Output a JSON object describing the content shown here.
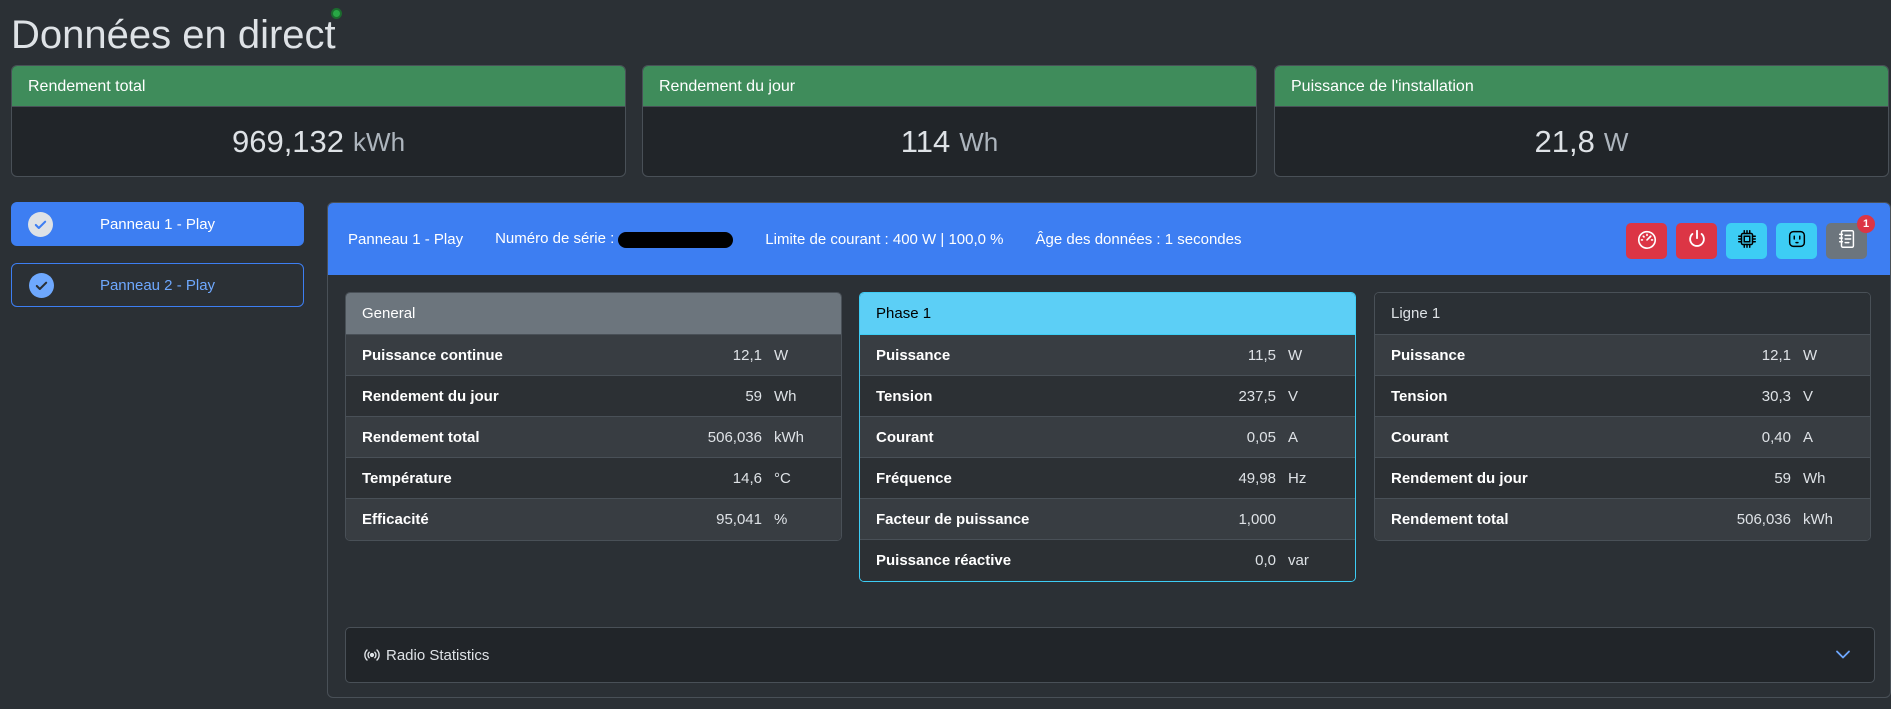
{
  "page": {
    "title": "Données en direct"
  },
  "summary": [
    {
      "label": "Rendement total",
      "value": "969,132",
      "unit": "kWh"
    },
    {
      "label": "Rendement du jour",
      "value": "114",
      "unit": "Wh"
    },
    {
      "label": "Puissance de l'installation",
      "value": "21,8",
      "unit": "W"
    }
  ],
  "inverters": [
    {
      "label": "Panneau 1 - Play",
      "active": true
    },
    {
      "label": "Panneau 2 - Play",
      "active": false
    }
  ],
  "inverter_header": {
    "name": "Panneau 1 - Play",
    "serial_label": "Numéro de série :",
    "limit": "Limite de courant : 400 W | 100,0 %",
    "age": "Âge des données : 1 secondes",
    "badge_count": "1"
  },
  "general": {
    "title": "General",
    "rows": [
      {
        "name": "Puissance continue",
        "value": "12,1",
        "unit": "W"
      },
      {
        "name": "Rendement du jour",
        "value": "59",
        "unit": "Wh"
      },
      {
        "name": "Rendement total",
        "value": "506,036",
        "unit": "kWh"
      },
      {
        "name": "Température",
        "value": "14,6",
        "unit": "°C"
      },
      {
        "name": "Efficacité",
        "value": "95,041",
        "unit": "%"
      }
    ]
  },
  "phase": {
    "title": "Phase 1",
    "rows": [
      {
        "name": "Puissance",
        "value": "11,5",
        "unit": "W"
      },
      {
        "name": "Tension",
        "value": "237,5",
        "unit": "V"
      },
      {
        "name": "Courant",
        "value": "0,05",
        "unit": "A"
      },
      {
        "name": "Fréquence",
        "value": "49,98",
        "unit": "Hz"
      },
      {
        "name": "Facteur de puissance",
        "value": "1,000",
        "unit": ""
      },
      {
        "name": "Puissance réactive",
        "value": "0,0",
        "unit": "var"
      }
    ]
  },
  "ligne": {
    "title": "Ligne 1",
    "rows": [
      {
        "name": "Puissance",
        "value": "12,1",
        "unit": "W"
      },
      {
        "name": "Tension",
        "value": "30,3",
        "unit": "V"
      },
      {
        "name": "Courant",
        "value": "0,40",
        "unit": "A"
      },
      {
        "name": "Rendement du jour",
        "value": "59",
        "unit": "Wh"
      },
      {
        "name": "Rendement total",
        "value": "506,036",
        "unit": "kWh"
      }
    ]
  },
  "radio": {
    "label": "Radio Statistics"
  },
  "colors": {
    "background": "#2b3035",
    "summary_header": "#3f8c5b",
    "primary": "#3d7ef2",
    "danger": "#dc3545",
    "info": "#3dcdf5",
    "secondary": "#6c757d"
  },
  "icons": {
    "limit_button": "gauge-icon",
    "power_button": "power-icon",
    "device_info_button": "chip-icon",
    "grid_profile_button": "outlet-icon",
    "event_log_button": "notebook-icon",
    "radio": "radio-waves-icon",
    "accordion": "chevron-down-icon",
    "tab_check": "check-circle-icon"
  }
}
